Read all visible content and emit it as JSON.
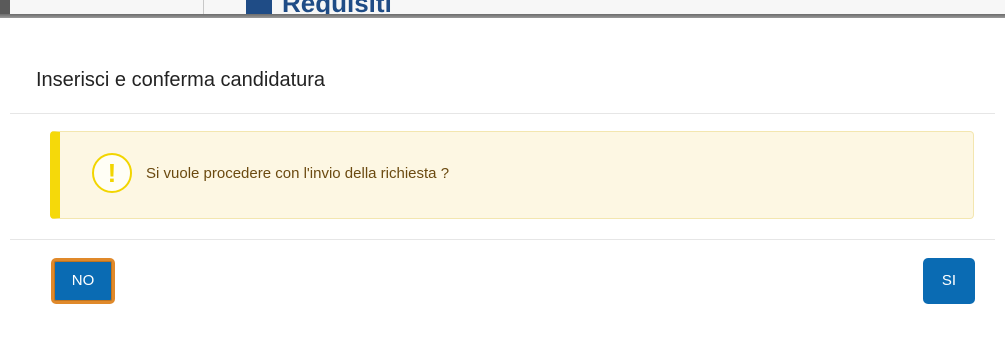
{
  "backdrop": {
    "brand_text": "Requisiti"
  },
  "modal": {
    "title": "Inserisci e conferma candidatura",
    "alert": {
      "icon": "exclamation-warning-icon",
      "icon_glyph": "!",
      "message": "Si vuole procedere con l'invio della richiesta ?",
      "accent_color": "#f5d90a",
      "background_color": "#fdf7e3"
    },
    "footer": {
      "no_label": "NO",
      "si_label": "SI",
      "button_color": "#0a6bb3",
      "focus_outline_color": "#e0892a"
    }
  }
}
